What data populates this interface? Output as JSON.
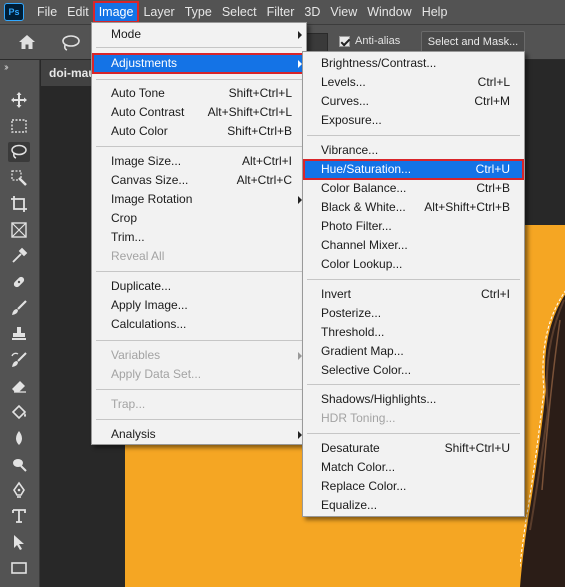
{
  "menubar": {
    "logo": "Ps",
    "items": [
      "File",
      "Edit",
      "Image",
      "Layer",
      "Type",
      "Select",
      "Filter",
      "3D",
      "View",
      "Window",
      "Help"
    ],
    "active_index": 2
  },
  "options_bar": {
    "antialias_label": "Anti-alias",
    "antialias_checked": true,
    "select_mask_label": "Select and Mask..."
  },
  "document": {
    "tab_label": "doi-mau",
    "canvas_color": "#f5a623"
  },
  "image_menu": {
    "items": [
      {
        "label": "Mode",
        "shortcut": "",
        "submenu": true,
        "disabled": false
      },
      {
        "label": "Adjustments",
        "shortcut": "",
        "submenu": true,
        "disabled": false,
        "highlighted": true
      },
      {
        "label": "Auto Tone",
        "shortcut": "Shift+Ctrl+L",
        "submenu": false,
        "disabled": false
      },
      {
        "label": "Auto Contrast",
        "shortcut": "Alt+Shift+Ctrl+L",
        "submenu": false,
        "disabled": false
      },
      {
        "label": "Auto Color",
        "shortcut": "Shift+Ctrl+B",
        "submenu": false,
        "disabled": false
      },
      {
        "label": "Image Size...",
        "shortcut": "Alt+Ctrl+I",
        "submenu": false,
        "disabled": false
      },
      {
        "label": "Canvas Size...",
        "shortcut": "Alt+Ctrl+C",
        "submenu": false,
        "disabled": false
      },
      {
        "label": "Image Rotation",
        "shortcut": "",
        "submenu": true,
        "disabled": false
      },
      {
        "label": "Crop",
        "shortcut": "",
        "submenu": false,
        "disabled": false
      },
      {
        "label": "Trim...",
        "shortcut": "",
        "submenu": false,
        "disabled": false
      },
      {
        "label": "Reveal All",
        "shortcut": "",
        "submenu": false,
        "disabled": true
      },
      {
        "label": "Duplicate...",
        "shortcut": "",
        "submenu": false,
        "disabled": false
      },
      {
        "label": "Apply Image...",
        "shortcut": "",
        "submenu": false,
        "disabled": false
      },
      {
        "label": "Calculations...",
        "shortcut": "",
        "submenu": false,
        "disabled": false
      },
      {
        "label": "Variables",
        "shortcut": "",
        "submenu": true,
        "disabled": true
      },
      {
        "label": "Apply Data Set...",
        "shortcut": "",
        "submenu": false,
        "disabled": true
      },
      {
        "label": "Trap...",
        "shortcut": "",
        "submenu": false,
        "disabled": true
      },
      {
        "label": "Analysis",
        "shortcut": "",
        "submenu": true,
        "disabled": false
      }
    ]
  },
  "adjustments_menu": {
    "items": [
      {
        "label": "Brightness/Contrast...",
        "shortcut": "",
        "disabled": false
      },
      {
        "label": "Levels...",
        "shortcut": "Ctrl+L",
        "disabled": false
      },
      {
        "label": "Curves...",
        "shortcut": "Ctrl+M",
        "disabled": false
      },
      {
        "label": "Exposure...",
        "shortcut": "",
        "disabled": false
      },
      {
        "label": "Vibrance...",
        "shortcut": "",
        "disabled": false
      },
      {
        "label": "Hue/Saturation...",
        "shortcut": "Ctrl+U",
        "disabled": false,
        "highlighted": true
      },
      {
        "label": "Color Balance...",
        "shortcut": "Ctrl+B",
        "disabled": false
      },
      {
        "label": "Black & White...",
        "shortcut": "Alt+Shift+Ctrl+B",
        "disabled": false
      },
      {
        "label": "Photo Filter...",
        "shortcut": "",
        "disabled": false
      },
      {
        "label": "Channel Mixer...",
        "shortcut": "",
        "disabled": false
      },
      {
        "label": "Color Lookup...",
        "shortcut": "",
        "disabled": false
      },
      {
        "label": "Invert",
        "shortcut": "Ctrl+I",
        "disabled": false
      },
      {
        "label": "Posterize...",
        "shortcut": "",
        "disabled": false
      },
      {
        "label": "Threshold...",
        "shortcut": "",
        "disabled": false
      },
      {
        "label": "Gradient Map...",
        "shortcut": "",
        "disabled": false
      },
      {
        "label": "Selective Color...",
        "shortcut": "",
        "disabled": false
      },
      {
        "label": "Shadows/Highlights...",
        "shortcut": "",
        "disabled": false
      },
      {
        "label": "HDR Toning...",
        "shortcut": "",
        "disabled": true
      },
      {
        "label": "Desaturate",
        "shortcut": "Shift+Ctrl+U",
        "disabled": false
      },
      {
        "label": "Match Color...",
        "shortcut": "",
        "disabled": false
      },
      {
        "label": "Replace Color...",
        "shortcut": "",
        "disabled": false
      },
      {
        "label": "Equalize...",
        "shortcut": "",
        "disabled": false
      }
    ]
  },
  "toolbar": {
    "tools": [
      "move-tool",
      "marquee-tool",
      "lasso-tool",
      "quick-selection-tool",
      "crop-tool",
      "frame-tool",
      "eyedropper-tool",
      "healing-brush-tool",
      "brush-tool",
      "clone-stamp-tool",
      "history-brush-tool",
      "eraser-tool",
      "paint-bucket-tool",
      "blur-tool",
      "dodge-tool",
      "pen-tool",
      "type-tool",
      "path-selection-tool",
      "rectangle-tool"
    ],
    "selected": "lasso-tool"
  },
  "colors": {
    "menu_highlight": "#1473e6",
    "callout_red": "#d9252a",
    "canvas_orange": "#f5a623",
    "chrome": "#535353"
  }
}
